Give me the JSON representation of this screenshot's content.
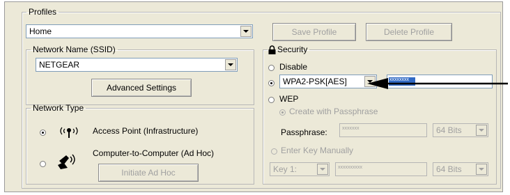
{
  "profiles": {
    "legend": "Profiles",
    "selected": "Home",
    "save_label": "Save Profile",
    "delete_label": "Delete Profile"
  },
  "ssid": {
    "legend": "Network Name (SSID)",
    "selected": "NETGEAR",
    "advanced_label": "Advanced Settings"
  },
  "network_type": {
    "legend": "Network Type",
    "access_point_label": "Access Point (Infrastructure)",
    "adhoc_label": "Computer-to-Computer (Ad Hoc)",
    "initiate_label": "Initiate Ad Hoc"
  },
  "security": {
    "legend": "Security",
    "disable_label": "Disable",
    "mode_selected": "WPA2-PSK[AES]",
    "key_masked": "xxxxxxxx",
    "wep_label": "WEP",
    "create_pass_label": "Create with Passphrase",
    "passphrase_label": "Passphrase:",
    "passphrase_masked": "xxxxxxx",
    "bits_1": "64 Bits",
    "enter_manual_label": "Enter Key Manually",
    "key_slot": "Key 1:",
    "manual_key_masked": "xxxxxxxxxx",
    "bits_2": "64 Bits"
  },
  "colors": {
    "panel_bg": "#ece9d8",
    "selection_highlight": "#316ac5",
    "annotation_arrow": "#000000"
  },
  "icons": [
    "lock-icon",
    "access-point-icon",
    "adhoc-icon",
    "annotation-arrow"
  ]
}
